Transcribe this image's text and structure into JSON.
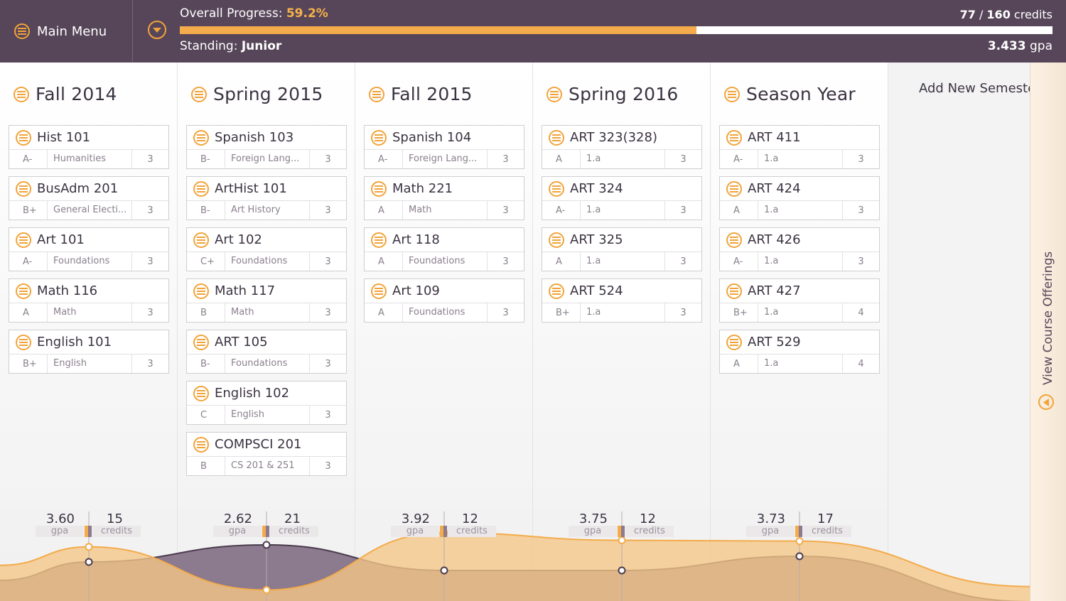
{
  "header": {
    "main_menu": "Main Menu",
    "progress_text": "Overall Progress: ",
    "progress_value": "59.2%",
    "progress_fraction": 0.592,
    "standing_text": "Standing: ",
    "standing_value": "Junior",
    "credits_done": "77",
    "credits_sep": " / ",
    "credits_total": "160",
    "credits_unit": " credits",
    "gpa_value": "3.433",
    "gpa_unit": " gpa"
  },
  "colors": {
    "header_bg": "#574659",
    "accent": "#f3ab4b",
    "purple_area": "#8c7a8e",
    "orange_area": "#f5c787"
  },
  "semesters": [
    {
      "title": "Fall 2014",
      "gpa": "3.60",
      "credits": "15",
      "gpa_num": 3.6,
      "credits_num": 15,
      "courses": [
        {
          "name": "Hist 101",
          "grade": "A-",
          "category": "Humanities",
          "credits": "3"
        },
        {
          "name": "BusAdm 201",
          "grade": "B+",
          "category": "General Electi...",
          "credits": "3"
        },
        {
          "name": "Art 101",
          "grade": "A-",
          "category": "Foundations",
          "credits": "3"
        },
        {
          "name": "Math 116",
          "grade": "A",
          "category": "Math",
          "credits": "3"
        },
        {
          "name": "English 101",
          "grade": "B+",
          "category": "English",
          "credits": "3"
        }
      ]
    },
    {
      "title": "Spring 2015",
      "gpa": "2.62",
      "credits": "21",
      "gpa_num": 2.62,
      "credits_num": 21,
      "courses": [
        {
          "name": "Spanish 103",
          "grade": "B-",
          "category": "Foreign Lang...",
          "credits": "3"
        },
        {
          "name": "ArtHist 101",
          "grade": "B-",
          "category": "Art History",
          "credits": "3"
        },
        {
          "name": "Art 102",
          "grade": "C+",
          "category": "Foundations",
          "credits": "3"
        },
        {
          "name": "Math 117",
          "grade": "B",
          "category": "Math",
          "credits": "3"
        },
        {
          "name": "ART 105",
          "grade": "B-",
          "category": "Foundations",
          "credits": "3"
        },
        {
          "name": "English 102",
          "grade": "C",
          "category": "English",
          "credits": "3"
        },
        {
          "name": "COMPSCI 201",
          "grade": "B",
          "category": "CS 201 & 251",
          "credits": "3"
        }
      ]
    },
    {
      "title": "Fall 2015",
      "gpa": "3.92",
      "credits": "12",
      "gpa_num": 3.92,
      "credits_num": 12,
      "courses": [
        {
          "name": "Spanish 104",
          "grade": "A-",
          "category": "Foreign Lang...",
          "credits": "3"
        },
        {
          "name": "Math 221",
          "grade": "A",
          "category": "Math",
          "credits": "3"
        },
        {
          "name": "Art 118",
          "grade": "A",
          "category": "Foundations",
          "credits": "3"
        },
        {
          "name": "Art 109",
          "grade": "A",
          "category": "Foundations",
          "credits": "3"
        }
      ]
    },
    {
      "title": "Spring 2016",
      "gpa": "3.75",
      "credits": "12",
      "gpa_num": 3.75,
      "credits_num": 12,
      "courses": [
        {
          "name": "ART 323(328)",
          "grade": "A",
          "category": "1.a",
          "credits": "3"
        },
        {
          "name": "ART 324",
          "grade": "A-",
          "category": "1.a",
          "credits": "3"
        },
        {
          "name": "ART 325",
          "grade": "A",
          "category": "1.a",
          "credits": "3"
        },
        {
          "name": "ART 524",
          "grade": "B+",
          "category": "1.a",
          "credits": "3"
        }
      ]
    },
    {
      "title": "Season Year",
      "gpa": "3.73",
      "credits": "17",
      "gpa_num": 3.73,
      "credits_num": 17,
      "courses": [
        {
          "name": "ART 411",
          "grade": "A-",
          "category": "1.a",
          "credits": "3"
        },
        {
          "name": "ART 424",
          "grade": "A",
          "category": "1.a",
          "credits": "3"
        },
        {
          "name": "ART 426",
          "grade": "A-",
          "category": "1.a",
          "credits": "3"
        },
        {
          "name": "ART 427",
          "grade": "B+",
          "category": "1.a",
          "credits": "4"
        },
        {
          "name": "ART 529",
          "grade": "A",
          "category": "1.a",
          "credits": "4"
        }
      ]
    }
  ],
  "stat_labels": {
    "gpa": "gpa",
    "credits": "credits"
  },
  "add_semester": "Add New Semester",
  "side_tab": "View Course Offerings"
}
